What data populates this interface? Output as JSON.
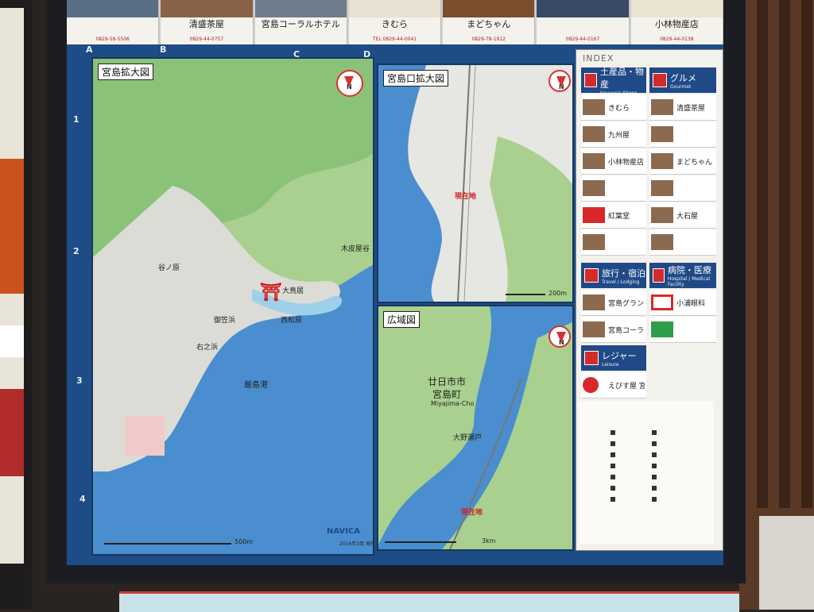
{
  "ads": [
    {
      "name": "",
      "tel": "0829-56-5506"
    },
    {
      "name": "清盛茶屋",
      "tel": "0829-44-0757"
    },
    {
      "name": "宮島コーラルホテル",
      "tel": ""
    },
    {
      "name": "きむら",
      "tel": "TEL.0829-44-0041"
    },
    {
      "name": "まどちゃん",
      "tel": "0829-78-1912"
    },
    {
      "name": "",
      "tel": "0829-44-0167"
    },
    {
      "name": "小林物産店",
      "tel": "0829-44-0138"
    }
  ],
  "grid": {
    "cols": [
      "A",
      "B",
      "C",
      "D"
    ],
    "rows": [
      "1",
      "2",
      "3",
      "4"
    ]
  },
  "maps": {
    "main": {
      "title": "宮島拡大図",
      "labels": [
        "大鳥居",
        "厳島港",
        "西松原",
        "御笠浜",
        "木皮屋谷",
        "谷ノ原",
        "右之浜"
      ],
      "scale": "500m",
      "brand": "NAVICA",
      "date": "2016年3月 現在"
    },
    "port": {
      "title": "宮島口拡大図",
      "here": "現在地",
      "scale": "200m"
    },
    "wide": {
      "title": "広域図",
      "city": "廿日市市",
      "town": "宮島町",
      "town_en": "Miyajima-Cho",
      "strait": "大野瀬戸",
      "here": "現在地",
      "scale": "3km"
    }
  },
  "index": {
    "title": "INDEX",
    "categories": [
      {
        "label": "土産品・物産",
        "sub": "Souvenir Shops"
      },
      {
        "label": "グルメ",
        "sub": "Gourmet"
      },
      {
        "label": "旅行・宿泊",
        "sub": "Travel / Lodging"
      },
      {
        "label": "病院・医療",
        "sub": "Hospital / Medical Facility"
      },
      {
        "label": "レジャー",
        "sub": "Leisure"
      }
    ],
    "souvenir": [
      "きむら",
      "九州屋",
      "小林物産店",
      "",
      "紅葉堂",
      ""
    ],
    "gourmet": [
      "清盛茶屋",
      "",
      "まどちゃん",
      "",
      "大石屋",
      ""
    ],
    "travel": [
      "宮島グランドホテル",
      "宮島コーラルホテル"
    ],
    "medical": [
      "小浦眼科",
      ""
    ],
    "leisure": [
      "えびす屋 宮島"
    ]
  },
  "colors": {
    "sea": "#4a8ed0",
    "land": "#a9d08e",
    "urban": "#dcdcd6",
    "index_header": "#1f4a87",
    "accent_red": "#d21f1f"
  }
}
